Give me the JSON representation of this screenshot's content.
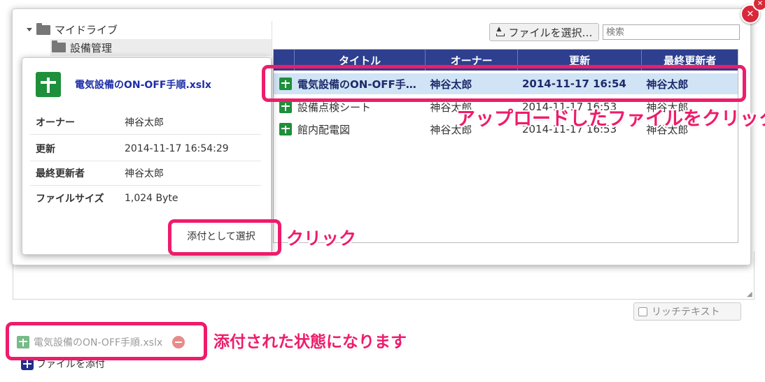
{
  "tree": {
    "root": "マイドライブ",
    "child": "設備管理"
  },
  "toolbar": {
    "upload_label": "ファイルを選択…",
    "search_placeholder": "検索"
  },
  "table": {
    "headers": [
      "タイトル",
      "オーナー",
      "更新",
      "最終更新者"
    ],
    "rows": [
      {
        "title": "電気設備のON-OFF手…",
        "owner": "神谷太郎",
        "updated": "2014-11-17 16:54",
        "last_editor": "神谷太郎"
      },
      {
        "title": "設備点検シート",
        "owner": "神谷太郎",
        "updated": "2014-11-17 16:53",
        "last_editor": "神谷太郎"
      },
      {
        "title": "館内配電図",
        "owner": "神谷太郎",
        "updated": "2014-11-17 16:53",
        "last_editor": "神谷太郎"
      }
    ]
  },
  "popover": {
    "file_name": "電気設備のON-OFF手順.xslx",
    "fields": [
      {
        "label": "オーナー",
        "value": "神谷太郎"
      },
      {
        "label": "更新",
        "value": "2014-11-17 16:54:29"
      },
      {
        "label": "最終更新者",
        "value": "神谷太郎"
      },
      {
        "label": "ファイルサイズ",
        "value": "1,024 Byte"
      }
    ],
    "select_label": "添付として選択"
  },
  "editor": {
    "richtext_label": "リッチテキスト"
  },
  "attachments": {
    "file_name": "電気設備のON-OFF手順.xslx",
    "add_label": "ファイルを添付"
  },
  "annotations": {
    "click_uploaded": "アップロードしたファイルをクリック",
    "click": "クリック",
    "attached_state": "添付された状態になります"
  },
  "colors": {
    "header_bg": "#2d3f8e",
    "selected_row": "#d0e4f5",
    "annotation": "#ee1c6b",
    "sheet_icon": "#1e8f3a"
  }
}
